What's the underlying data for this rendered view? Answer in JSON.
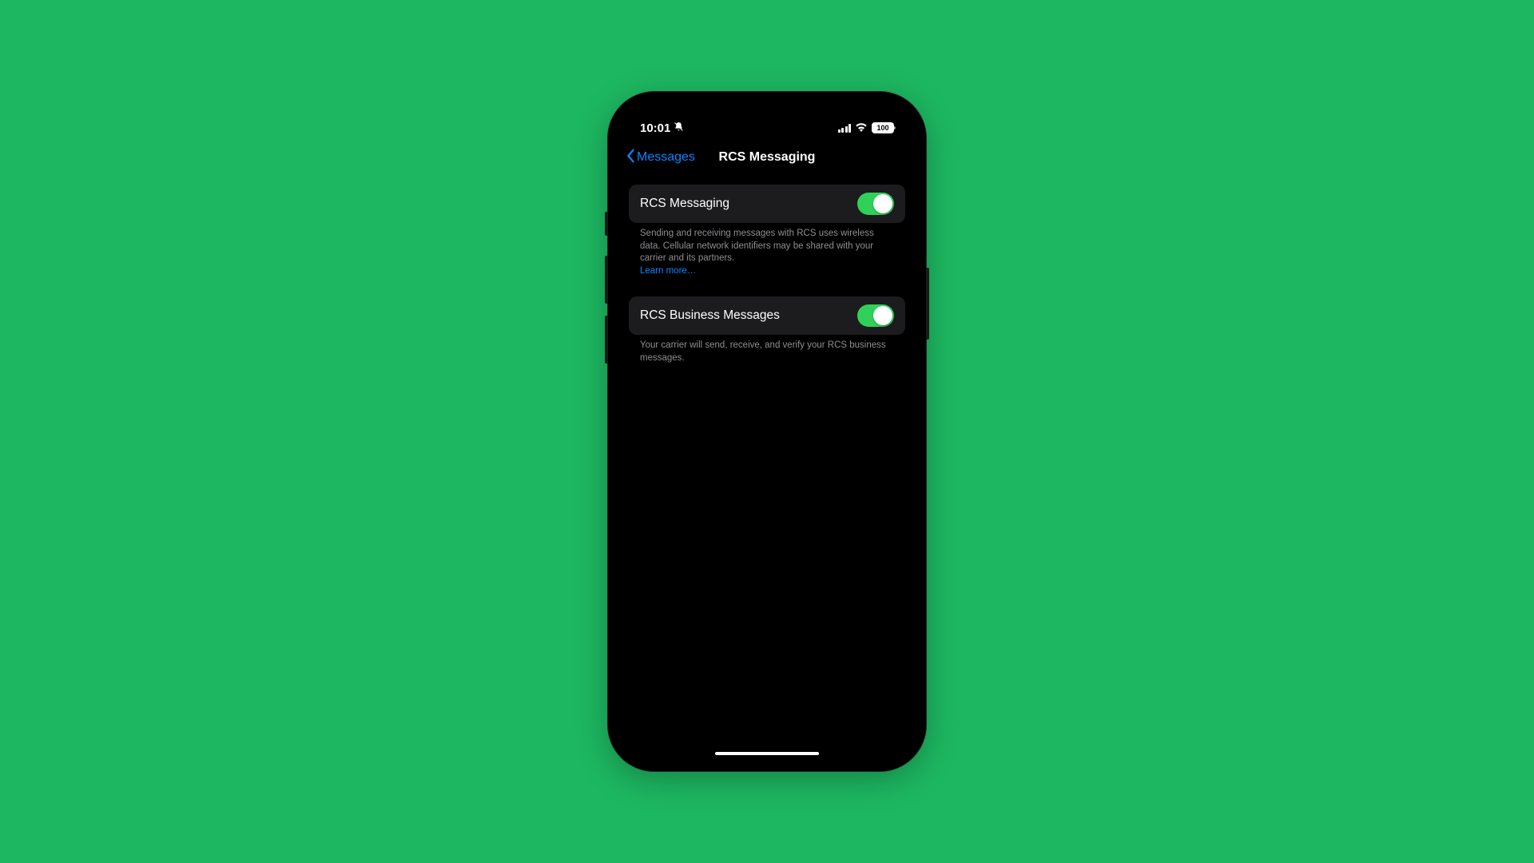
{
  "status": {
    "time": "10:01",
    "battery": "100"
  },
  "nav": {
    "back_label": "Messages",
    "title": "RCS Messaging"
  },
  "settings": {
    "rcs": {
      "label": "RCS Messaging",
      "enabled": true,
      "footer": "Sending and receiving messages with RCS uses wireless data. Cellular network identifiers may be shared with your carrier and its partners.",
      "learn_more": "Learn more…"
    },
    "business": {
      "label": "RCS Business Messages",
      "enabled": true,
      "footer": "Your carrier will send, receive, and verify your RCS business messages."
    }
  },
  "colors": {
    "background": "#1db761",
    "accent": "#0a84ff",
    "toggle_on": "#30d158",
    "row_bg": "#1c1c1e"
  }
}
